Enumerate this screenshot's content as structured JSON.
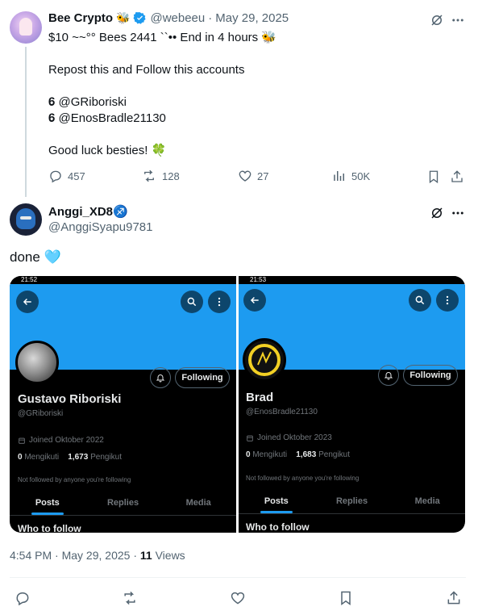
{
  "tweet": {
    "author_name": "Bee Crypto",
    "author_emoji": "🐝",
    "author_handle": "@webeeu",
    "dot": "·",
    "date": "May 29, 2025",
    "line1": "$10 ~~°° Bees 2441 ``•• End in 4 hours 🐝",
    "line2": "Repost this and Follow this accounts",
    "line3": "𝟔 @GRiboriski",
    "line4": "𝟔 @EnosBradle21130",
    "line5": "Good luck besties! 🍀",
    "replies": "457",
    "reposts": "128",
    "likes": "27",
    "views": "50K"
  },
  "reply": {
    "author_name": "Anggi_XD8♐",
    "author_handle": "@AnggiSyapu9781",
    "text": "done 🩵",
    "time": "4:54 PM",
    "dot": "·",
    "date": "May 29, 2025",
    "dot2": "·",
    "views_count": "11",
    "views_label": "Views"
  },
  "screenshots": [
    {
      "status_time": "21:52",
      "name": "Gustavo Riboriski",
      "handle": "@GRiboriski",
      "joined": "Joined Oktober 2022",
      "following_count": "0",
      "following_label": "Mengikuti",
      "followers_count": "1,673",
      "followers_label": "Pengikut",
      "not_followed": "Not followed by anyone you're following",
      "follow_button": "Following",
      "tabs": [
        "Posts",
        "Replies",
        "Media"
      ],
      "who_to_follow": "Who to follow"
    },
    {
      "status_time": "21:53",
      "name": "Brad",
      "handle": "@EnosBradle21130",
      "joined": "Joined Oktober 2023",
      "following_count": "0",
      "following_label": "Mengikuti",
      "followers_count": "1,683",
      "followers_label": "Pengikut",
      "not_followed": "Not followed by anyone you're following",
      "follow_button": "Following",
      "tabs": [
        "Posts",
        "Replies",
        "Media"
      ],
      "who_to_follow": "Who to follow"
    }
  ],
  "colors": {
    "accent": "#1d9bf0",
    "verified": "#1d9bf0",
    "muted": "#536471"
  }
}
